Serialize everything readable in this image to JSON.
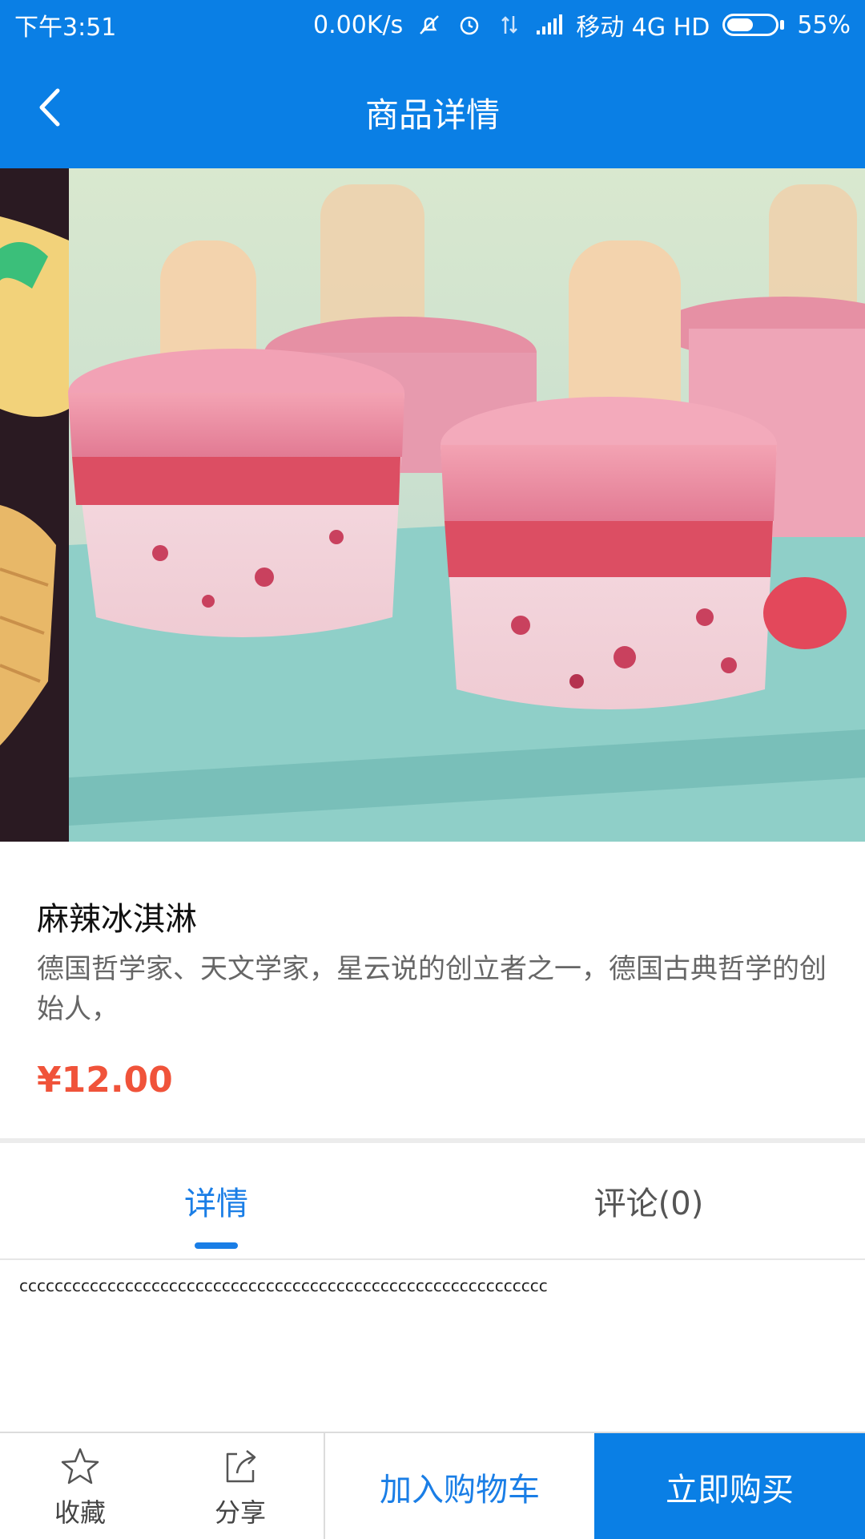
{
  "status_bar": {
    "time": "下午3:51",
    "speed": "0.00K/s",
    "carrier": "移动 4G HD",
    "battery_text": "55%",
    "battery_level": 0.55
  },
  "app_bar": {
    "title": "商品详情",
    "back_icon": "back-arrow-icon"
  },
  "banner": {
    "page_count": 2,
    "active_index": 0,
    "active_dot_color": "#f5b800",
    "inactive_dot_color": "#ffffff"
  },
  "product": {
    "name": "麻辣冰淇淋",
    "description": "德国哲学家、天文学家，星云说的创立者之一，德国古典哲学的创始人，",
    "price": "¥12.00"
  },
  "tabs": [
    {
      "label": "详情",
      "active": true
    },
    {
      "label": "评论(0)",
      "active": false
    }
  ],
  "details_content": "cccccccccccccccccccccccccccccccccccccccccccccccccccccccccccc",
  "bottom_bar": {
    "favorite_label": "收藏",
    "share_label": "分享",
    "add_to_cart_label": "加入购物车",
    "buy_now_label": "立即购买"
  },
  "colors": {
    "primary": "#0a7fe5",
    "price": "#f0533a"
  }
}
